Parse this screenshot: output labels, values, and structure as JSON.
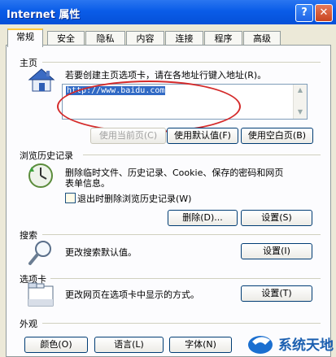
{
  "window": {
    "title": "Internet 属性",
    "help_label": "?",
    "close_label": "✕"
  },
  "tabs": [
    {
      "label": "常规",
      "active": true
    },
    {
      "label": "安全"
    },
    {
      "label": "隐私"
    },
    {
      "label": "内容"
    },
    {
      "label": "连接"
    },
    {
      "label": "程序"
    },
    {
      "label": "高级"
    }
  ],
  "home": {
    "group_label": "主页",
    "description": "若要创建主页选项卡，请在各地址行键入地址(R)。",
    "url": "http://www.baidu.com",
    "btn_current": "使用当前页(C)",
    "btn_default": "使用默认值(F)",
    "btn_blank": "使用空白页(B)"
  },
  "history": {
    "group_label": "浏览历史记录",
    "description_line1": "删除临时文件、历史记录、Cookie、保存的密码和网页",
    "description_line2": "表单信息。",
    "checkbox_label": "退出时删除浏览历史记录(W)",
    "btn_delete": "删除(D)...",
    "btn_settings": "设置(S)"
  },
  "search": {
    "group_label": "搜索",
    "description": "更改搜索默认值。",
    "btn_settings": "设置(I)"
  },
  "tabs_section": {
    "group_label": "选项卡",
    "description": "更改网页在选项卡中显示的方式。",
    "btn_settings": "设置(T)"
  },
  "appearance": {
    "group_label": "外观",
    "btn_colors": "颜色(O)",
    "btn_languages": "语言(L)",
    "btn_fonts": "字体(N)"
  },
  "watermark": {
    "text": "系统天地"
  },
  "colors": {
    "titlebar": "#0a5ce8",
    "dialog_bg": "#ece9d8",
    "highlight": "#316ac5",
    "annotation": "#d42a2a"
  }
}
